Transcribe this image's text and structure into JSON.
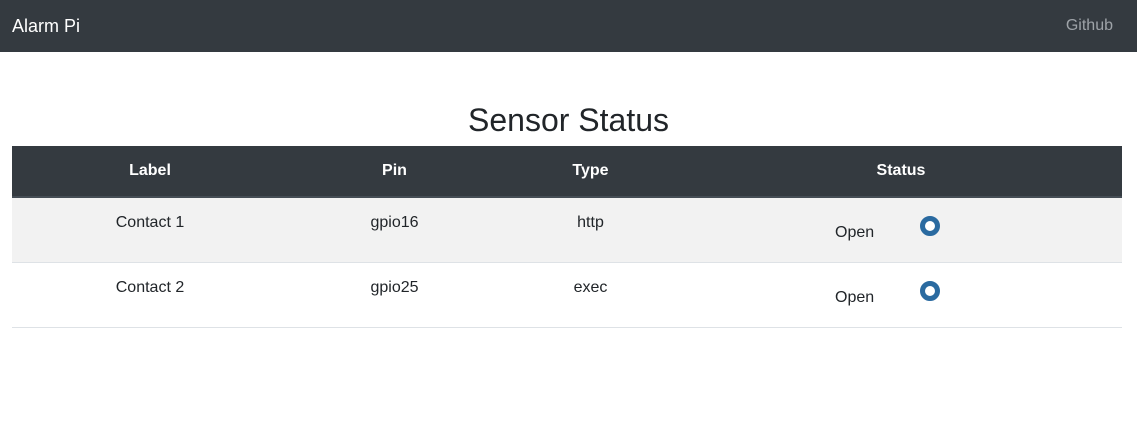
{
  "navbar": {
    "brand": "Alarm Pi",
    "links": [
      {
        "label": "Github"
      }
    ]
  },
  "page": {
    "title": "Sensor Status"
  },
  "table": {
    "headers": [
      "Label",
      "Pin",
      "Type",
      "Status"
    ],
    "rows": [
      {
        "label": "Contact 1",
        "pin": "gpio16",
        "type": "http",
        "status": "Open",
        "indicator_icon": "status-ring-icon"
      },
      {
        "label": "Contact 2",
        "pin": "gpio25",
        "type": "exec",
        "status": "Open",
        "indicator_icon": "status-ring-icon"
      }
    ]
  },
  "colors": {
    "navbar_bg": "#343a40",
    "table_header_bg": "#343a40",
    "stripe_bg": "#f2f2f2",
    "indicator": "#2a6aa0"
  }
}
